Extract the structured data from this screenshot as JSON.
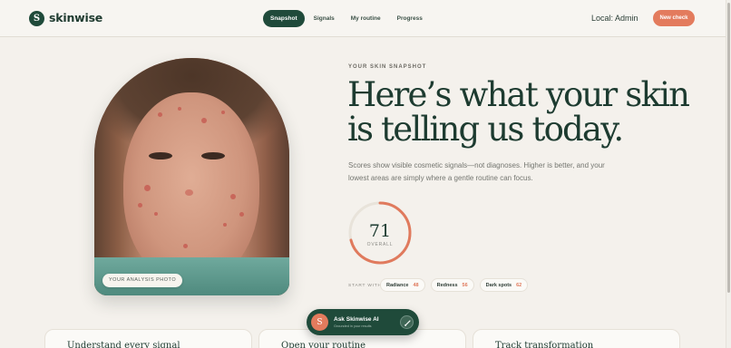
{
  "brand": {
    "logo_letter": "S",
    "name": "skinwise"
  },
  "nav": {
    "items": [
      {
        "label": "Snapshot",
        "active": true
      },
      {
        "label": "Signals",
        "active": false
      },
      {
        "label": "My routine",
        "active": false
      },
      {
        "label": "Progress",
        "active": false
      }
    ]
  },
  "header": {
    "local_user": "Local: Admin",
    "new_check_label": "New check"
  },
  "photo": {
    "badge": "YOUR ANALYSIS PHOTO"
  },
  "snapshot": {
    "eyebrow": "YOUR SKIN SNAPSHOT",
    "headline_line1": "Here’s what your skin",
    "headline_line2": "is telling us today.",
    "subtext_line1": "Scores show visible cosmetic signals—not diagnoses. Higher is better, and your",
    "subtext_line2": "lowest areas are simply where a gentle routine can focus.",
    "overall_score": "71",
    "overall_fraction": 0.71,
    "overall_label": "OVERALL",
    "start_with_label": "START WITH",
    "focus_chips": [
      {
        "label": "Radiance",
        "value": "48"
      },
      {
        "label": "Redness",
        "value": "56"
      },
      {
        "label": "Dark spots",
        "value": "62"
      }
    ]
  },
  "cards": [
    {
      "title": "Understand every signal"
    },
    {
      "title": "Open your routine"
    },
    {
      "title": "Track transformation"
    }
  ],
  "assistant": {
    "avatar_letter": "S",
    "title": "Ask Skinwise AI",
    "subtitle": "Grounded in your results",
    "button_icon": "pencil-icon"
  },
  "colors": {
    "brand_green": "#1f4a3a",
    "accent_coral": "#e37b5d",
    "background": "#f4f1ec"
  }
}
